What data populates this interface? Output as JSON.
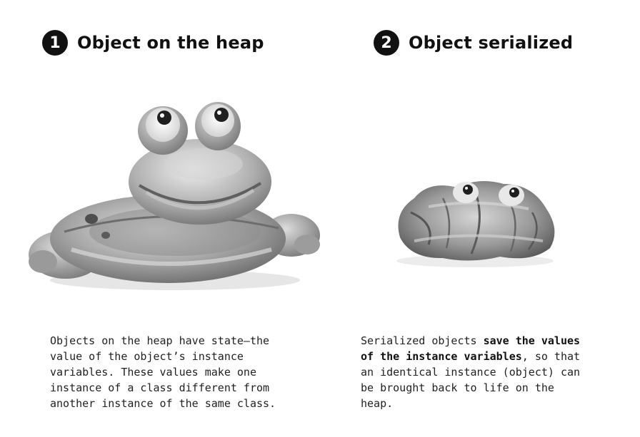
{
  "panel_left": {
    "number": "1",
    "heading": "Object on the heap",
    "image_icon": "inflated-toy-frog-icon",
    "caption": "Objects on the heap have state—the value of the object’s instance variables. These values make one instance of a class different from another instance of the same class."
  },
  "panel_right": {
    "number": "2",
    "heading": "Object serialized",
    "image_icon": "deflated-toy-frog-icon",
    "caption_part1": "Serialized objects ",
    "caption_bold": "save the values of the instance variables",
    "caption_part2": ", so that an identical instance (object) can be brought back to life on the heap."
  },
  "colors": {
    "ink": "#111111",
    "toy_light": "#cfcfcf",
    "toy_mid": "#9a9a9a",
    "toy_dark": "#5a5a5a"
  }
}
